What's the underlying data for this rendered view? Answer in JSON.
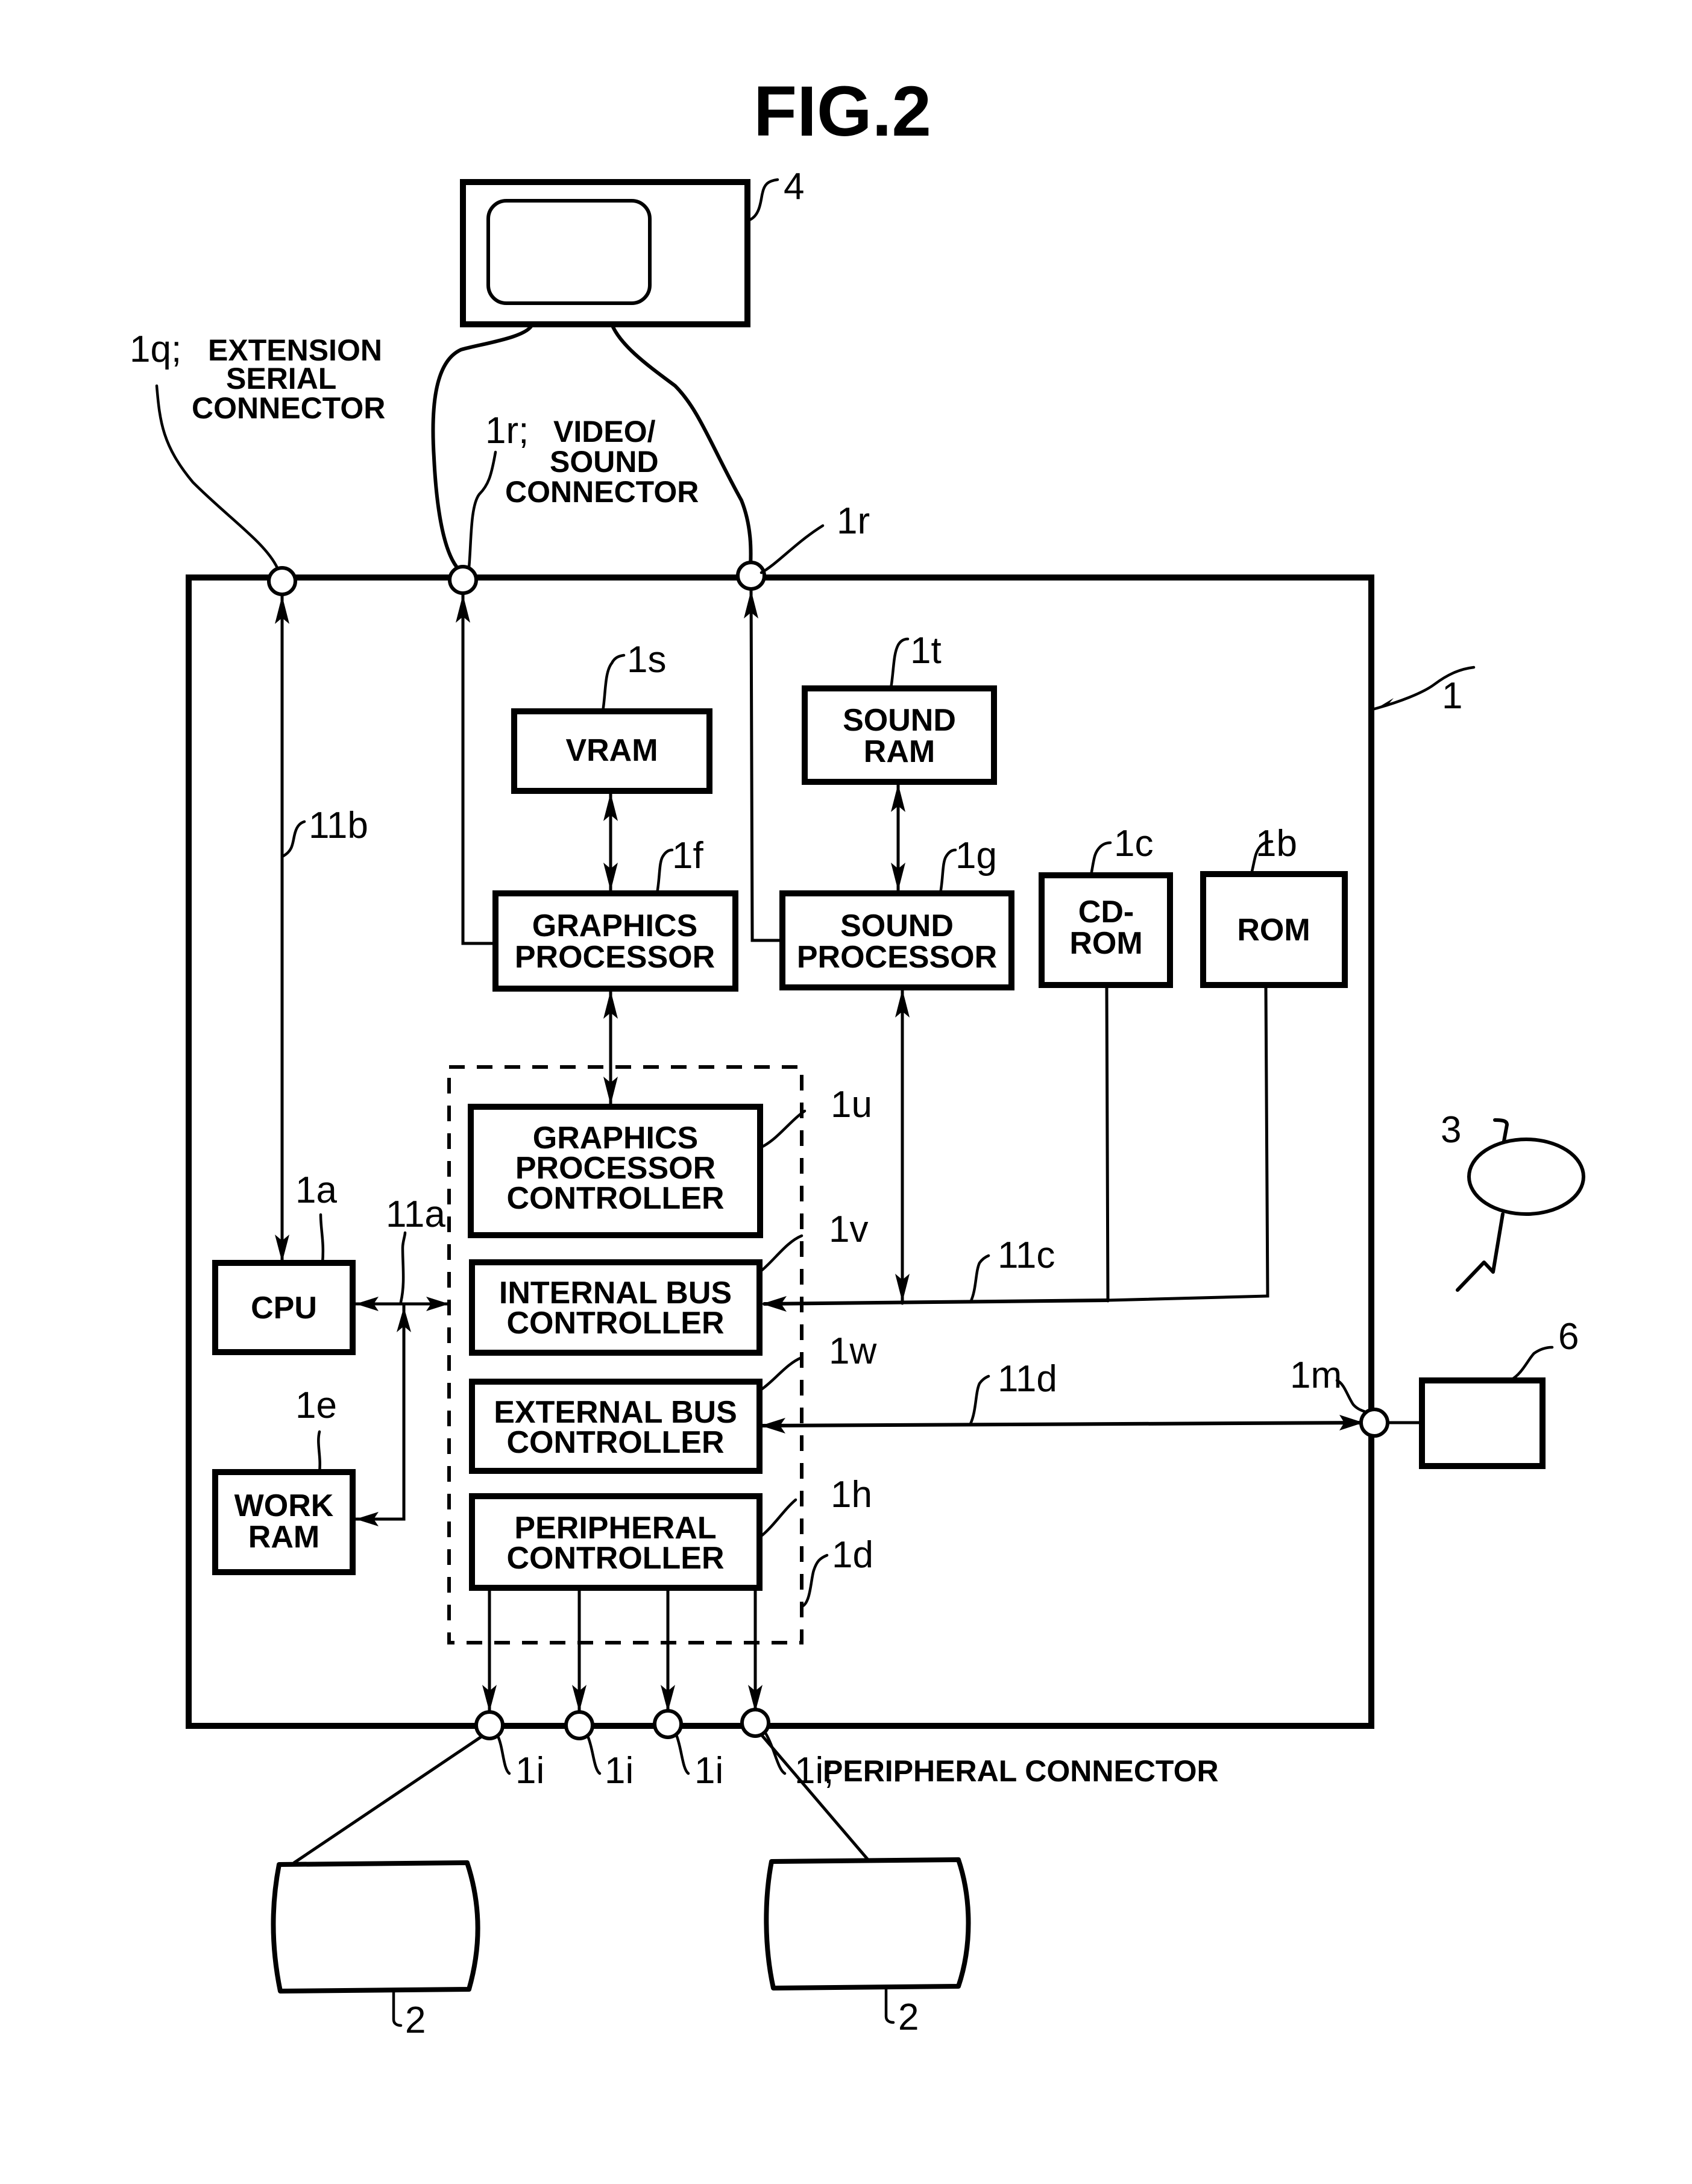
{
  "figure": {
    "title": "FIG.2"
  },
  "monitor": {
    "ref": "4"
  },
  "main_unit": {
    "ref": "1"
  },
  "connectors": {
    "extension_serial": {
      "ref": "1q;",
      "caption_lines": [
        "EXTENSION",
        "SERIAL",
        "CONNECTOR"
      ]
    },
    "video_sound": {
      "ref": "1r;",
      "caption_lines": [
        "VIDEO/",
        "SOUND",
        "CONNECTOR"
      ]
    },
    "video_sound_2": {
      "ref": "1r"
    },
    "peripheral": {
      "refs": [
        "1i",
        "1i",
        "1i"
      ],
      "last_ref": "1i;",
      "caption": "PERIPHERAL CONNECTOR"
    },
    "memory_card": {
      "ref": "1m"
    }
  },
  "blocks": {
    "vram": {
      "ref": "1s",
      "lines": [
        "VRAM"
      ]
    },
    "sound_ram": {
      "ref": "1t",
      "lines": [
        "SOUND",
        "RAM"
      ]
    },
    "graphics_processor": {
      "ref": "1f",
      "lines": [
        "GRAPHICS",
        "PROCESSOR"
      ]
    },
    "sound_processor": {
      "ref": "1g",
      "lines": [
        "SOUND",
        "PROCESSOR"
      ]
    },
    "cd_rom": {
      "ref": "1c",
      "lines": [
        "CD-",
        "ROM"
      ]
    },
    "rom": {
      "ref": "1b",
      "lines": [
        "ROM"
      ]
    },
    "cpu": {
      "ref": "1a",
      "lines": [
        "CPU"
      ]
    },
    "work_ram": {
      "ref": "1e",
      "lines": [
        "WORK",
        "RAM"
      ]
    },
    "gp_controller": {
      "ref": "1u",
      "lines": [
        "GRAPHICS",
        "PROCESSOR",
        "CONTROLLER"
      ]
    },
    "internal_bus_controller": {
      "ref": "1v",
      "lines": [
        "INTERNAL BUS",
        "CONTROLLER"
      ]
    },
    "external_bus_controller": {
      "ref": "1w",
      "lines": [
        "EXTERNAL BUS",
        "CONTROLLER"
      ]
    },
    "peripheral_controller": {
      "ref": "1h",
      "lines": [
        "PERIPHERAL",
        "CONTROLLER"
      ]
    },
    "controller_group": {
      "ref": "1d"
    }
  },
  "buses": {
    "bus_11a": "11a",
    "bus_11b": "11b",
    "bus_11c": "11c",
    "bus_11d": "11d"
  },
  "external_devices": {
    "memory_card": {
      "ref": "6"
    },
    "antenna_device": {
      "ref": "3"
    },
    "controller_left": {
      "ref": "2"
    },
    "controller_right": {
      "ref": "2"
    }
  }
}
